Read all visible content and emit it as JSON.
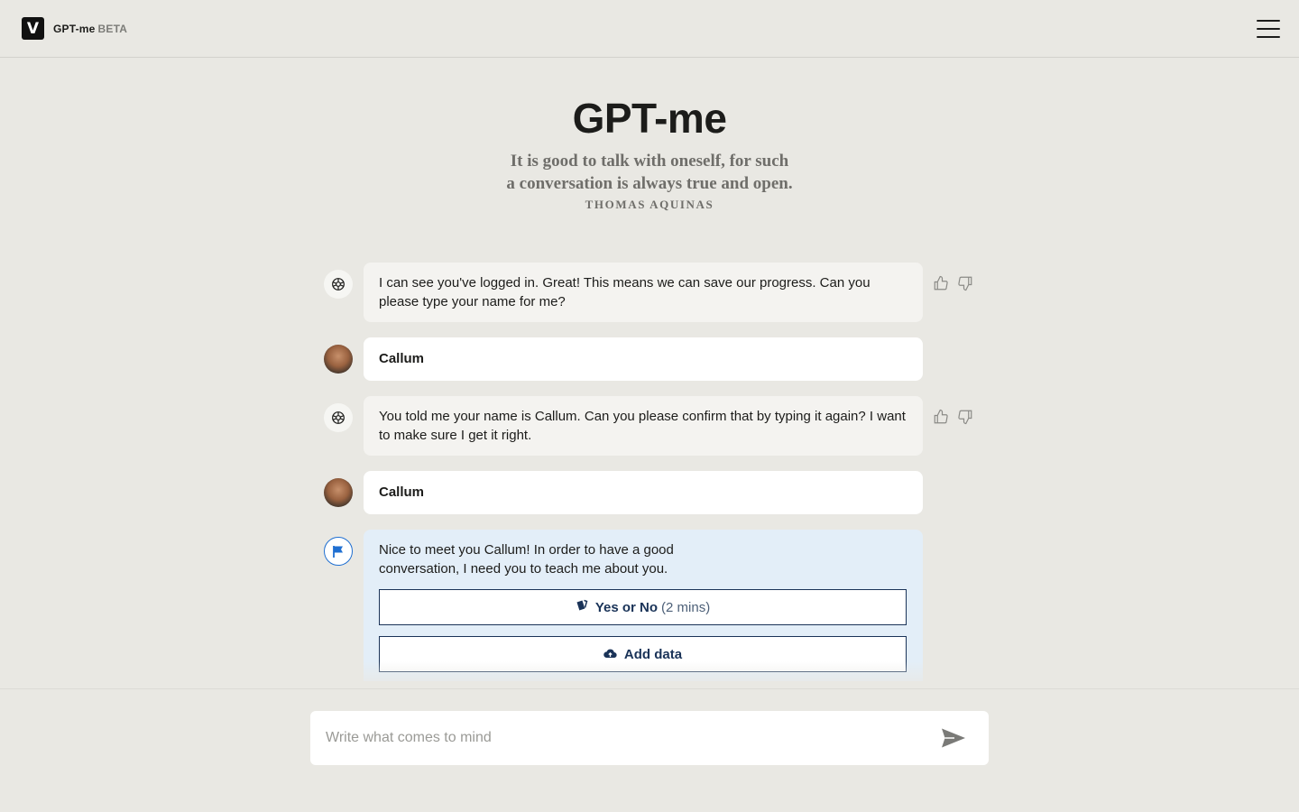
{
  "header": {
    "logo_letter": "V",
    "app_name": "GPT-me",
    "badge": "BETA",
    "menu_icon": "hamburger-menu-icon"
  },
  "hero": {
    "title": "GPT-me",
    "quote_line1": "It is good to talk with oneself, for such",
    "quote_line2": "a conversation is always true and open.",
    "author": "THOMAS AQUINAS"
  },
  "messages": [
    {
      "role": "bot",
      "icon": "ai-logo-icon",
      "text": "I can see you've logged in. Great! This means we can save our progress. Can you please type your name for me?",
      "feedback": [
        "thumbs-up-icon",
        "thumbs-down-icon"
      ]
    },
    {
      "role": "user",
      "icon": "user-avatar",
      "text": "Callum"
    },
    {
      "role": "bot",
      "icon": "ai-logo-icon",
      "text": "You told me your name is Callum. Can you please confirm that by typing it again? I want to make sure I get it right.",
      "feedback": [
        "thumbs-up-icon",
        "thumbs-down-icon"
      ]
    },
    {
      "role": "user",
      "icon": "user-avatar",
      "text": "Callum"
    },
    {
      "role": "system",
      "icon": "flag-icon",
      "text": "Nice to meet you Callum! In order to have a good conversation, I need you to teach me about you.",
      "options": [
        {
          "icon": "cards-icon",
          "label": "Yes or No",
          "note": "(2 mins)"
        },
        {
          "icon": "cloud-upload-icon",
          "label": "Add data"
        }
      ]
    }
  ],
  "composer": {
    "placeholder": "Write what comes to mind",
    "send_icon": "send-icon"
  },
  "colors": {
    "background": "#e9e8e3",
    "bot_bubble": "#f4f3f0",
    "user_bubble": "#ffffff",
    "info_bubble": "#e3eef8",
    "accent": "#1a3358",
    "flag_blue": "#1f6fd1"
  }
}
